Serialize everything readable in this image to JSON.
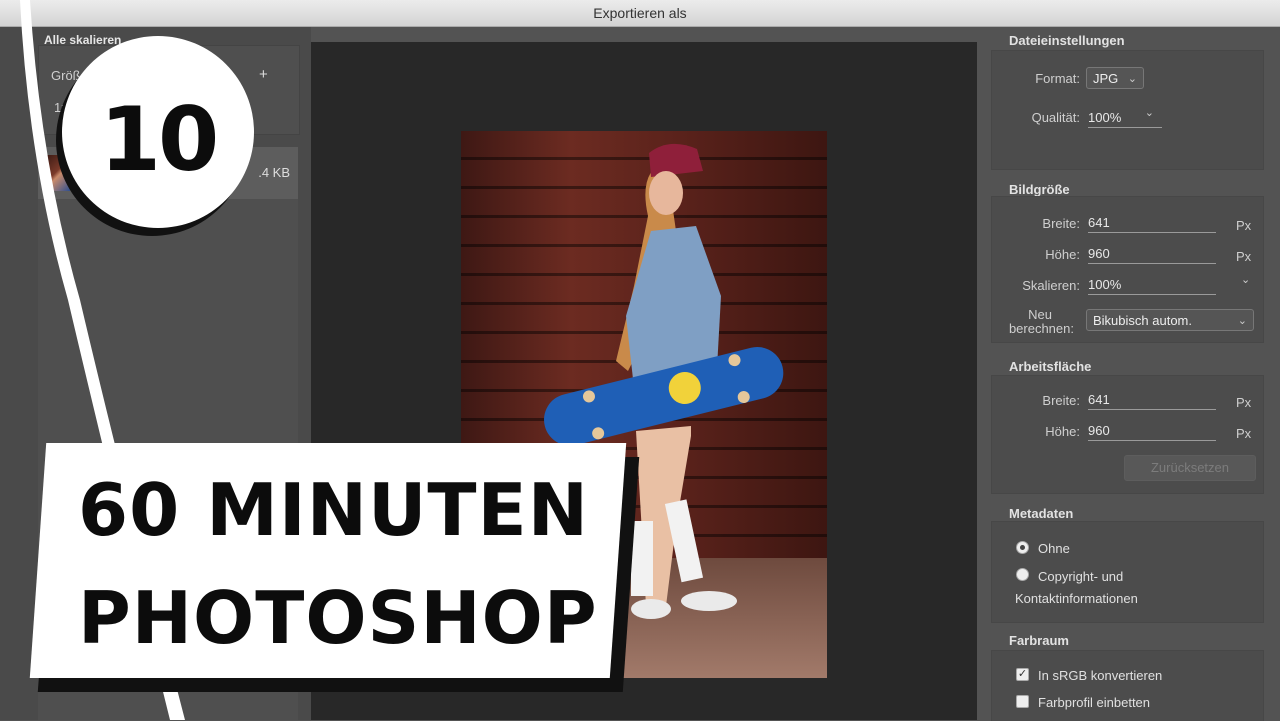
{
  "window": {
    "title": "Exportieren als"
  },
  "left": {
    "header": "Alle skalieren",
    "size_label": "Größe",
    "scale_value": "1x",
    "add_symbol": "+",
    "asset_size": ".4 KB"
  },
  "file_settings": {
    "title": "Dateieinstellungen",
    "format_label": "Format:",
    "format_value": "JPG",
    "quality_label": "Qualität:",
    "quality_value": "100%"
  },
  "image_size": {
    "title": "Bildgröße",
    "width_label": "Breite:",
    "width_value": "641",
    "height_label": "Höhe:",
    "height_value": "960",
    "scale_label": "Skalieren:",
    "scale_value": "100%",
    "resample_label_1": "Neu",
    "resample_label_2": "berechnen:",
    "resample_value": "Bikubisch autom.",
    "unit": "Px"
  },
  "canvas": {
    "title": "Arbeitsfläche",
    "width_label": "Breite:",
    "width_value": "641",
    "height_label": "Höhe:",
    "height_value": "960",
    "unit": "Px",
    "reset_label": "Zurücksetzen"
  },
  "metadata": {
    "title": "Metadaten",
    "option_none": "Ohne",
    "option_copyright_1": "Copyright- und",
    "option_copyright_2": "Kontaktinformationen",
    "selected": "none"
  },
  "color_space": {
    "title": "Farbraum",
    "convert_label": "In sRGB konvertieren",
    "convert_checked": true,
    "embed_label": "Farbprofil einbetten",
    "embed_checked": false
  },
  "overlay": {
    "badge_number": "10",
    "line1": "60 MINUTEN",
    "line2": "PHOTOSHOP"
  }
}
